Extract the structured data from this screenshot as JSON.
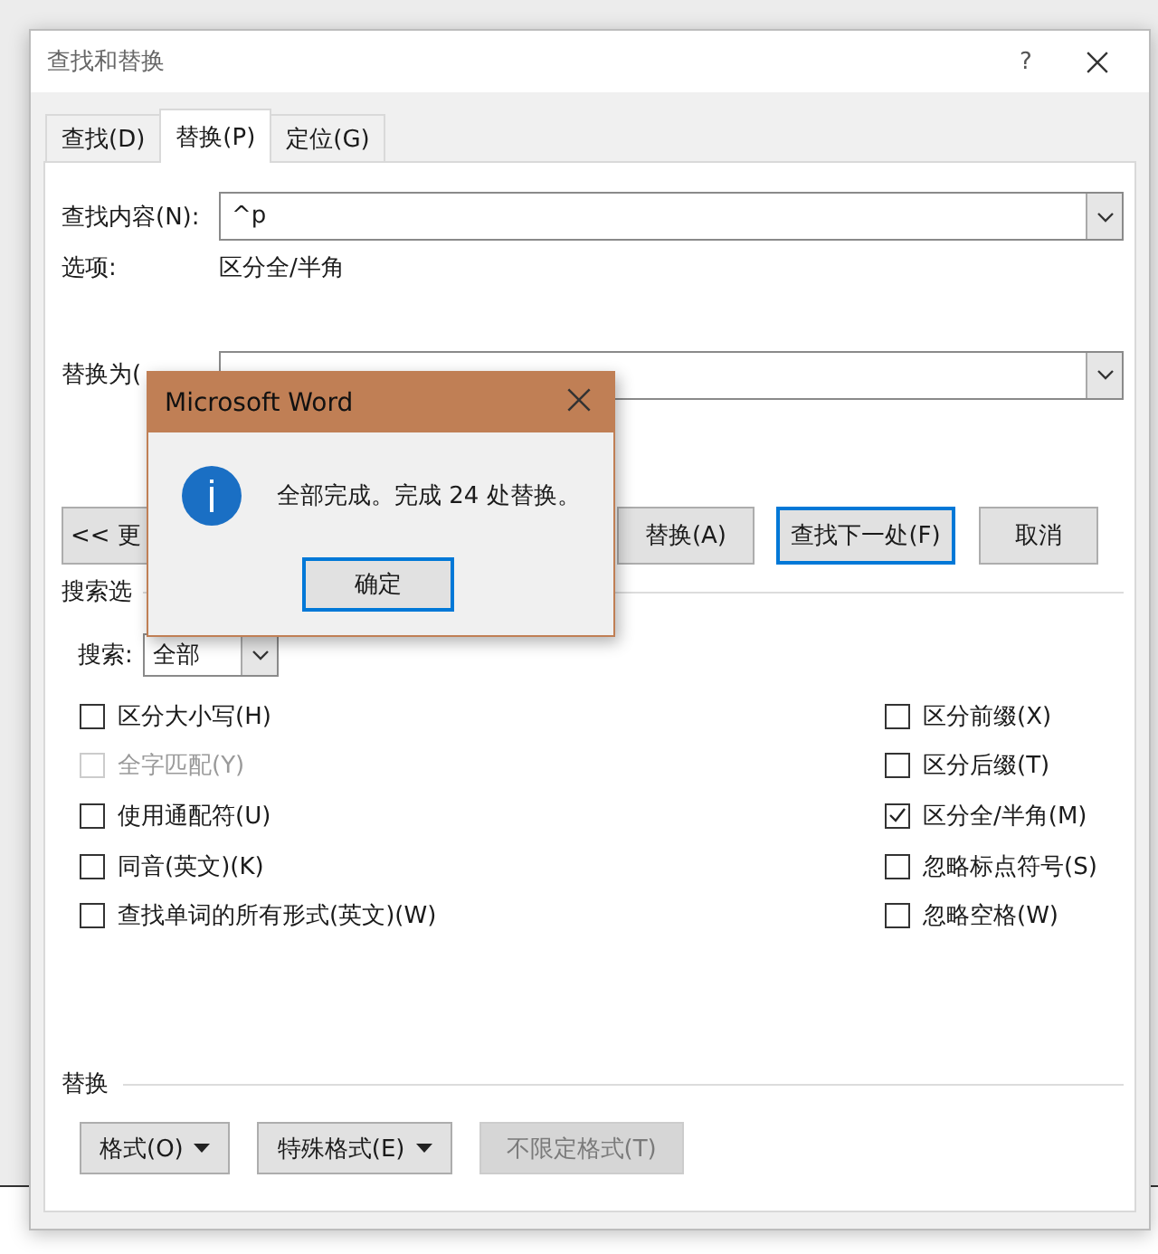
{
  "window": {
    "title": "查找和替换",
    "help": "?"
  },
  "tabs": [
    {
      "label": "查找(D)",
      "selected": false
    },
    {
      "label": "替换(P)",
      "selected": true
    },
    {
      "label": "定位(G)",
      "selected": false
    }
  ],
  "find": {
    "label": "查找内容(N):",
    "value": "^p"
  },
  "options": {
    "label": "选项:",
    "value": "区分全/半角"
  },
  "replace": {
    "label": "替换为("
  },
  "buttons": [
    {
      "label": "<< 更",
      "focused": false
    },
    {
      "label": "替换(A)",
      "focused": false
    },
    {
      "label": "查找下一处(F)",
      "focused": true
    },
    {
      "label": "取消",
      "focused": false
    }
  ],
  "search_options": {
    "label": "搜索选",
    "search_label": "搜索:",
    "search_value": "全部"
  },
  "checkboxes_left": [
    {
      "label": "区分大小写(H)",
      "checked": false,
      "disabled": false
    },
    {
      "label": "全字匹配(Y)",
      "checked": false,
      "disabled": true
    },
    {
      "label": "使用通配符(U)",
      "checked": false,
      "disabled": false
    },
    {
      "label": "同音(英文)(K)",
      "checked": false,
      "disabled": false
    },
    {
      "label": "查找单词的所有形式(英文)(W)",
      "checked": false,
      "disabled": false
    }
  ],
  "checkboxes_right": [
    {
      "label": "区分前缀(X)",
      "checked": false,
      "disabled": false
    },
    {
      "label": "区分后缀(T)",
      "checked": false,
      "disabled": false
    },
    {
      "label": "区分全/半角(M)",
      "checked": true,
      "disabled": false
    },
    {
      "label": "忽略标点符号(S)",
      "checked": false,
      "disabled": false
    },
    {
      "label": "忽略空格(W)",
      "checked": false,
      "disabled": false
    }
  ],
  "replace_section": {
    "label": "替换",
    "buttons": [
      {
        "label": "格式(O)",
        "kind": "menu",
        "disabled": false
      },
      {
        "label": "特殊格式(E)",
        "kind": "menu",
        "disabled": false
      },
      {
        "label": "不限定格式(T)",
        "kind": "plain",
        "disabled": true
      }
    ]
  },
  "message_box": {
    "title": "Microsoft Word",
    "message": "全部完成。完成 24 处替换。",
    "ok": "确定"
  }
}
